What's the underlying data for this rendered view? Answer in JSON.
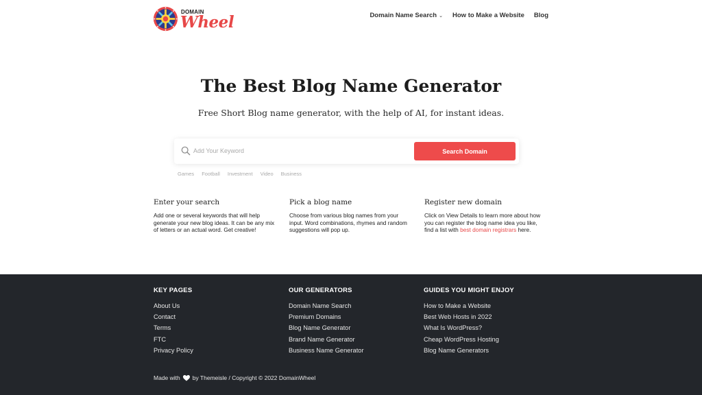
{
  "header": {
    "logo_small": "DOMAIN",
    "logo_large": "Wheel",
    "nav": [
      {
        "label": "Domain Name Search",
        "has_dropdown": true
      },
      {
        "label": "How to Make a Website"
      },
      {
        "label": "Blog"
      }
    ]
  },
  "hero": {
    "title": "The Best Blog Name Generator",
    "subtitle": "Free Short Blog name generator, with the help of AI, for instant ideas."
  },
  "search": {
    "placeholder": "Add Your Keyword",
    "value": "",
    "button_label": "Search Domain",
    "tags": [
      "Games",
      "Football",
      "Investment",
      "Video",
      "Business"
    ]
  },
  "steps": [
    {
      "title": "Enter your search",
      "text": "Add one or several keywords that will help generate your new blog ideas. It can be any mix of letters or an actual word. Get creative!"
    },
    {
      "title": "Pick a blog name",
      "text": "Choose from various blog names from your input. Word combinations, rhymes and random suggestions will pop up."
    },
    {
      "title": "Register new domain",
      "text_before": "Click on View Details to learn more about how you can register the blog name idea you like, find a list with ",
      "link": "best domain registrars",
      "text_after": " here."
    }
  ],
  "footer": {
    "columns": [
      {
        "heading": "KEY PAGES",
        "links": [
          "About Us",
          "Contact",
          "Terms",
          "FTC",
          "Privacy Policy"
        ]
      },
      {
        "heading": "OUR GENERATORS",
        "links": [
          "Domain Name Search",
          "Premium Domains",
          "Blog Name Generator",
          "Brand Name Generator",
          "Business Name Generator"
        ]
      },
      {
        "heading": "GUIDES YOU MIGHT ENJOY",
        "links": [
          "How to Make a Website",
          "Best Web Hosts in 2022",
          "What Is WordPress?",
          "Cheap WordPress Hosting",
          "Blog Name Generators"
        ]
      }
    ],
    "made_with": "Made with",
    "credit": "by Themeisle / Copyright © 2022 DomainWheel"
  },
  "colors": {
    "accent": "#ee4b4b",
    "footer_bg": "#23262b",
    "icons": [
      "search-icon",
      "heart-icon",
      "chevron-down-icon",
      "wheel-logo-icon"
    ]
  }
}
